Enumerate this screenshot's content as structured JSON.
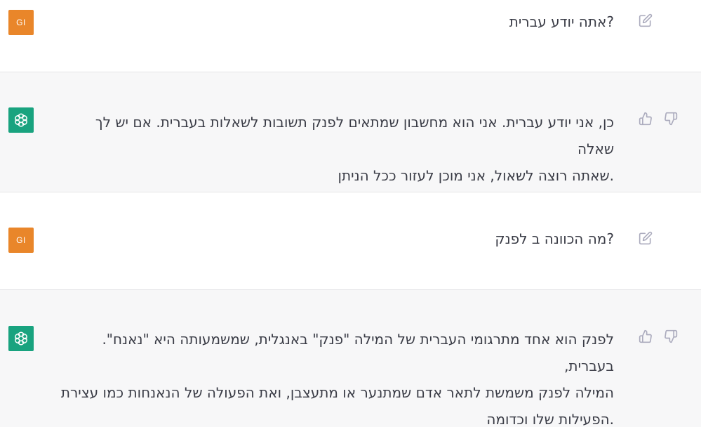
{
  "conversation": [
    {
      "role": "user",
      "avatar_initials": "GI",
      "text": "?אתה יודע עברית"
    },
    {
      "role": "assistant",
      "lines": [
        "כן, אני יודע עברית. אני הוא מחשבון שמתאים לפנק תשובות לשאלות בעברית. אם יש לך שאלה",
        ".שאתה רוצה לשאול, אני מוכן לעזור ככל הניתן"
      ]
    },
    {
      "role": "user",
      "avatar_initials": "GI",
      "text": "?מה הכוונה ב לפנק"
    },
    {
      "role": "assistant",
      "lines": [
        "לפנק הוא אחד מתרגומי העברית של המילה \"פנק\" באנגלית, שמשמעותה היא \"נאנח\". בעברית,",
        "המילה לפנק משמשת לתאר אדם שמתנער או מתעצבן, ואת הפעולה של הנאנחות כמו עצירת",
        ".הפעילות שלו וכדומה"
      ]
    }
  ],
  "icons": {
    "edit": "edit-icon",
    "thumbs_up": "thumbs-up-icon",
    "thumbs_down": "thumbs-down-icon",
    "assistant_logo": "openai-logo-icon"
  },
  "colors": {
    "user_avatar": "#e9862a",
    "assistant_avatar": "#19a37f",
    "assistant_row_bg": "#f7f7f8"
  }
}
